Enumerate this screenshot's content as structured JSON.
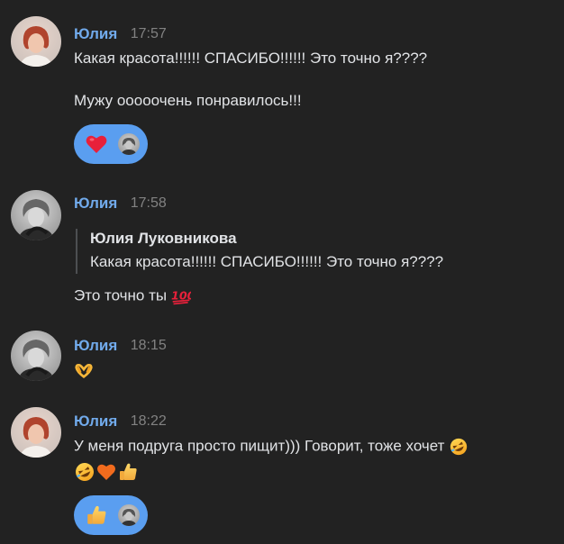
{
  "messages": [
    {
      "author": "Юлия",
      "time": "17:57",
      "lines": [
        "Какая красота!!!!!! СПАСИБО!!!!!! Это точно я????",
        "Мужу ооооочень понравилось!!!"
      ],
      "reaction": {
        "emoji": "heart-icon"
      }
    },
    {
      "author": "Юлия",
      "time": "17:58",
      "quote": {
        "author": "Юлия Луковникова",
        "text": "Какая красота!!!!!! СПАСИБО!!!!!! Это точно я????"
      },
      "text": "Это точно ты",
      "emoji": "hundred-points-icon"
    },
    {
      "author": "Юлия",
      "time": "18:15",
      "emoji": "heart-hands-icon"
    },
    {
      "author": "Юлия",
      "time": "18:22",
      "text": "У меня подруга просто пищит))) Говорит, тоже хочет",
      "emojis": [
        "rolling-laughing-icon",
        "rolling-laughing-icon",
        "orange-heart-icon",
        "thumbs-up-icon"
      ],
      "reaction": {
        "emoji": "thumbs-up-icon"
      }
    }
  ],
  "colors": {
    "background": "#222222",
    "author": "#71aaeb",
    "time": "#828282",
    "text": "#e1e3e6",
    "reaction_bg": "#5a9ef0"
  }
}
